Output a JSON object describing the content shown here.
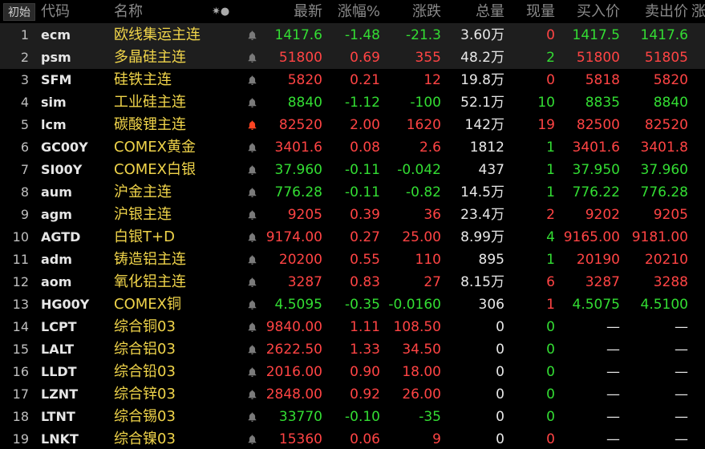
{
  "header": {
    "badge": "初始",
    "code": "代码",
    "name": "名称",
    "icons": "✷●",
    "last": "最新",
    "pct": "涨幅%",
    "chg": "涨跌",
    "vol": "总量",
    "cur": "现量",
    "bid": "买入价",
    "ask": "卖出价",
    "extra": "涨"
  },
  "colors": {
    "up": "#ff4444",
    "down": "#33dd33",
    "name": "#f0d44a",
    "alert": "#ff4422"
  },
  "rows": [
    {
      "idx": "1",
      "code": "ecm",
      "name": "欧线集运主连",
      "last": "1417.6",
      "pct": "-1.48",
      "chg": "-21.3",
      "vol": "3.60万",
      "cur": "0",
      "bid": "1417.5",
      "ask": "1417.6",
      "dir": "down",
      "curdir": "up",
      "alert": false,
      "sel": true
    },
    {
      "idx": "2",
      "code": "psm",
      "name": "多晶硅主连",
      "last": "51800",
      "pct": "0.69",
      "chg": "355",
      "vol": "48.2万",
      "cur": "2",
      "bid": "51800",
      "ask": "51805",
      "dir": "up",
      "curdir": "down",
      "alert": false,
      "sel": true
    },
    {
      "idx": "3",
      "code": "SFM",
      "name": "硅铁主连",
      "last": "5820",
      "pct": "0.21",
      "chg": "12",
      "vol": "19.8万",
      "cur": "0",
      "bid": "5818",
      "ask": "5820",
      "dir": "up",
      "curdir": "up",
      "alert": false,
      "sel": false
    },
    {
      "idx": "4",
      "code": "sim",
      "name": "工业硅主连",
      "last": "8840",
      "pct": "-1.12",
      "chg": "-100",
      "vol": "52.1万",
      "cur": "10",
      "bid": "8835",
      "ask": "8840",
      "dir": "down",
      "curdir": "down",
      "alert": false,
      "sel": false
    },
    {
      "idx": "5",
      "code": "lcm",
      "name": "碳酸锂主连",
      "last": "82520",
      "pct": "2.00",
      "chg": "1620",
      "vol": "142万",
      "cur": "19",
      "bid": "82500",
      "ask": "82520",
      "dir": "up",
      "curdir": "up",
      "alert": true,
      "sel": false
    },
    {
      "idx": "6",
      "code": "GC00Y",
      "name": "COMEX黄金",
      "last": "3401.6",
      "pct": "0.08",
      "chg": "2.6",
      "vol": "1812",
      "cur": "1",
      "bid": "3401.6",
      "ask": "3401.8",
      "dir": "up",
      "curdir": "down",
      "alert": false,
      "sel": false
    },
    {
      "idx": "7",
      "code": "SI00Y",
      "name": "COMEX白银",
      "last": "37.960",
      "pct": "-0.11",
      "chg": "-0.042",
      "vol": "437",
      "cur": "1",
      "bid": "37.950",
      "ask": "37.960",
      "dir": "down",
      "curdir": "down",
      "alert": false,
      "sel": false
    },
    {
      "idx": "8",
      "code": "aum",
      "name": "沪金主连",
      "last": "776.28",
      "pct": "-0.11",
      "chg": "-0.82",
      "vol": "14.5万",
      "cur": "1",
      "bid": "776.22",
      "ask": "776.28",
      "dir": "down",
      "curdir": "down",
      "alert": false,
      "sel": false
    },
    {
      "idx": "9",
      "code": "agm",
      "name": "沪银主连",
      "last": "9205",
      "pct": "0.39",
      "chg": "36",
      "vol": "23.4万",
      "cur": "2",
      "bid": "9202",
      "ask": "9205",
      "dir": "up",
      "curdir": "up",
      "alert": false,
      "sel": false
    },
    {
      "idx": "10",
      "code": "AGTD",
      "name": "白银T+D",
      "last": "9174.00",
      "pct": "0.27",
      "chg": "25.00",
      "vol": "8.99万",
      "cur": "4",
      "bid": "9165.00",
      "ask": "9181.00",
      "dir": "up",
      "curdir": "down",
      "alert": false,
      "sel": false
    },
    {
      "idx": "11",
      "code": "adm",
      "name": "铸造铝主连",
      "last": "20200",
      "pct": "0.55",
      "chg": "110",
      "vol": "895",
      "cur": "1",
      "bid": "20190",
      "ask": "20210",
      "dir": "up",
      "curdir": "down",
      "alert": false,
      "sel": false
    },
    {
      "idx": "12",
      "code": "aom",
      "name": "氧化铝主连",
      "last": "3287",
      "pct": "0.83",
      "chg": "27",
      "vol": "8.15万",
      "cur": "6",
      "bid": "3287",
      "ask": "3288",
      "dir": "up",
      "curdir": "up",
      "alert": false,
      "sel": false
    },
    {
      "idx": "13",
      "code": "HG00Y",
      "name": "COMEX铜",
      "last": "4.5095",
      "pct": "-0.35",
      "chg": "-0.0160",
      "vol": "306",
      "cur": "1",
      "bid": "4.5075",
      "ask": "4.5100",
      "dir": "down",
      "curdir": "up",
      "alert": false,
      "sel": false
    },
    {
      "idx": "14",
      "code": "LCPT",
      "name": "综合铜03",
      "last": "9840.00",
      "pct": "1.11",
      "chg": "108.50",
      "vol": "0",
      "cur": "0",
      "bid": "—",
      "ask": "—",
      "dir": "up",
      "curdir": "down",
      "alert": false,
      "sel": false,
      "nobidask": true
    },
    {
      "idx": "15",
      "code": "LALT",
      "name": "综合铝03",
      "last": "2622.50",
      "pct": "1.33",
      "chg": "34.50",
      "vol": "0",
      "cur": "0",
      "bid": "—",
      "ask": "—",
      "dir": "up",
      "curdir": "down",
      "alert": false,
      "sel": false,
      "nobidask": true
    },
    {
      "idx": "16",
      "code": "LLDT",
      "name": "综合铅03",
      "last": "2016.00",
      "pct": "0.90",
      "chg": "18.00",
      "vol": "0",
      "cur": "0",
      "bid": "—",
      "ask": "—",
      "dir": "up",
      "curdir": "down",
      "alert": false,
      "sel": false,
      "nobidask": true
    },
    {
      "idx": "17",
      "code": "LZNT",
      "name": "综合锌03",
      "last": "2848.00",
      "pct": "0.92",
      "chg": "26.00",
      "vol": "0",
      "cur": "0",
      "bid": "—",
      "ask": "—",
      "dir": "up",
      "curdir": "down",
      "alert": false,
      "sel": false,
      "nobidask": true
    },
    {
      "idx": "18",
      "code": "LTNT",
      "name": "综合锡03",
      "last": "33770",
      "pct": "-0.10",
      "chg": "-35",
      "vol": "0",
      "cur": "0",
      "bid": "—",
      "ask": "—",
      "dir": "down",
      "curdir": "down",
      "alert": false,
      "sel": false,
      "nobidask": true
    },
    {
      "idx": "19",
      "code": "LNKT",
      "name": "综合镍03",
      "last": "15360",
      "pct": "0.06",
      "chg": "9",
      "vol": "0",
      "cur": "0",
      "bid": "—",
      "ask": "—",
      "dir": "up",
      "curdir": "up",
      "alert": false,
      "sel": false,
      "nobidask": true
    }
  ]
}
